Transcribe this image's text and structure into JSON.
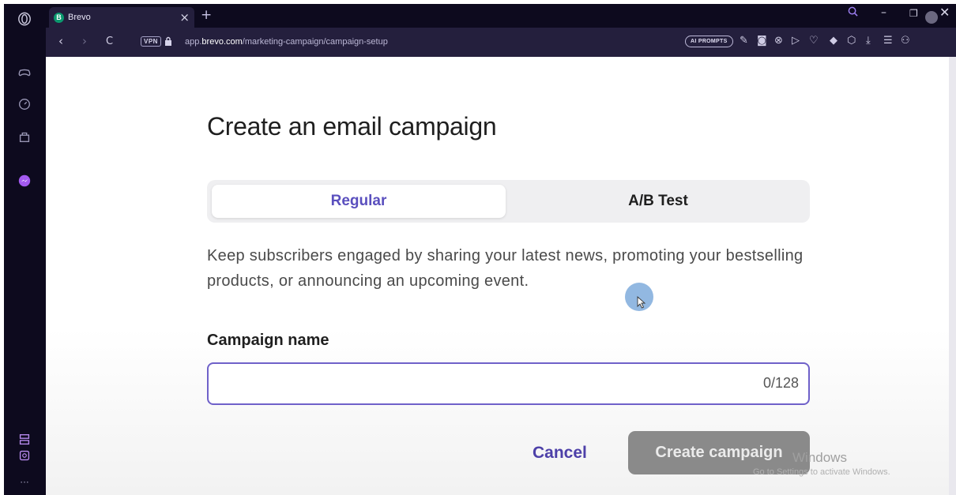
{
  "browser": {
    "tab_title": "Brevo",
    "tab_favicon_letter": "B",
    "tab_close": "×",
    "new_tab": "+",
    "vpn_badge": "VPN",
    "url_prefix": "app.",
    "url_domain": "brevo.com",
    "url_path": "/marketing-campaign/campaign-setup",
    "ai_prompts": "AI PROMPTS",
    "accent_color": "#0d0a1e"
  },
  "page": {
    "heading": "Create an email campaign",
    "tabs": [
      {
        "label": "Regular",
        "selected": true
      },
      {
        "label": "A/B Test",
        "selected": false
      }
    ],
    "description": "Keep subscribers engaged by sharing your latest news, promoting your bestselling products, or announcing an upcoming event.",
    "campaign_name_label": "Campaign name",
    "campaign_name_value": "",
    "campaign_name_counter": "0/128",
    "cancel_label": "Cancel",
    "create_label": "Create campaign",
    "brand_color": "#5a4fbe"
  },
  "overlay": {
    "activate_title": "Windows",
    "activate_sub": "Go to Settings to activate Windows."
  }
}
